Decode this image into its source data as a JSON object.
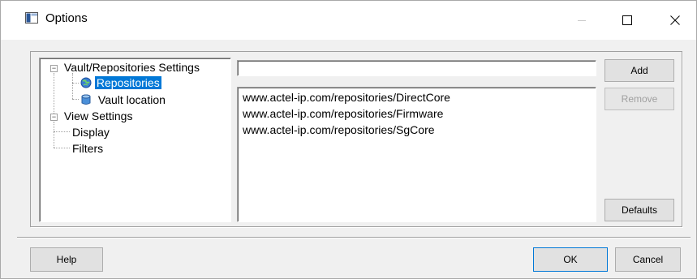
{
  "window": {
    "title": "Options",
    "controls": {
      "minimize": "—",
      "maximize": "☐",
      "close": "✕"
    }
  },
  "tree": {
    "nodes": [
      {
        "label": "Vault/Repositories Settings",
        "expander": "−"
      },
      {
        "label": "Repositories",
        "icon": "globe-icon",
        "selected": true
      },
      {
        "label": "Vault location",
        "icon": "database-icon"
      },
      {
        "label": "View Settings",
        "expander": "−"
      },
      {
        "label": "Display"
      },
      {
        "label": "Filters"
      }
    ]
  },
  "repositories": {
    "input_value": "",
    "items": [
      "www.actel-ip.com/repositories/DirectCore",
      "www.actel-ip.com/repositories/Firmware",
      "www.actel-ip.com/repositories/SgCore"
    ]
  },
  "buttons": {
    "add": "Add",
    "remove": "Remove",
    "defaults": "Defaults",
    "help": "Help",
    "ok": "OK",
    "cancel": "Cancel"
  },
  "colors": {
    "selection": "#0078d7",
    "window_bg": "#f0f0f0",
    "titlebar_bg": "#ffffff"
  }
}
